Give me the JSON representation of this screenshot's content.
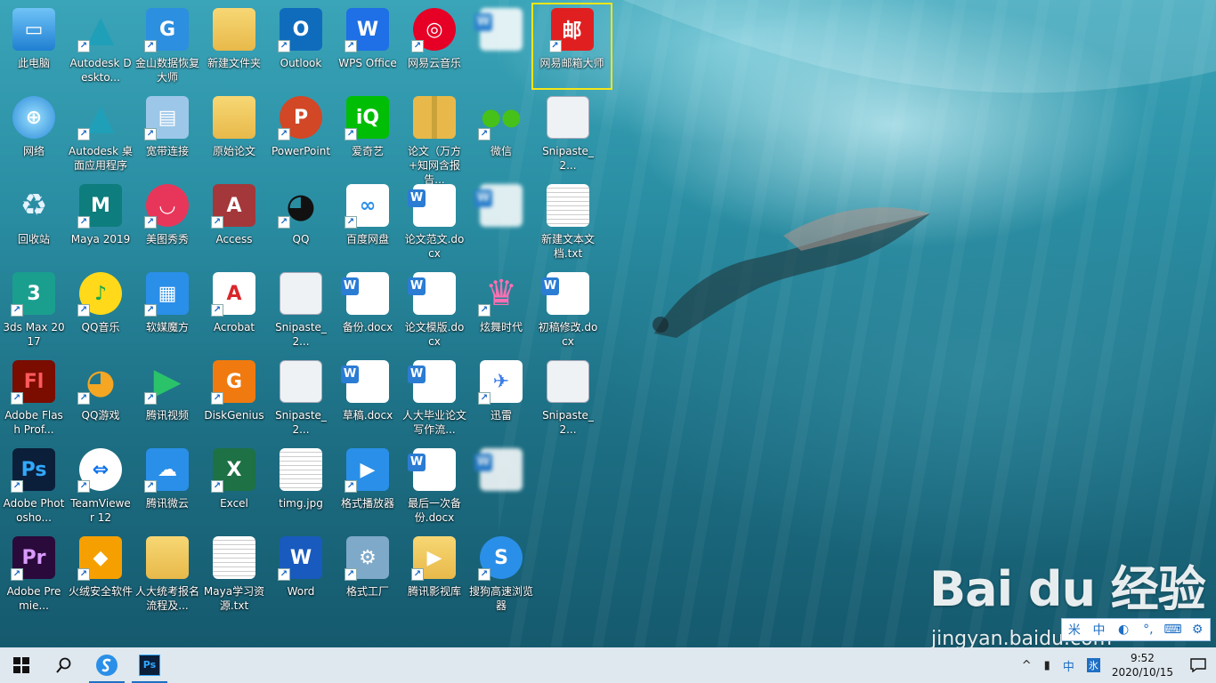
{
  "desktop": {
    "icons": [
      {
        "label": "此电脑",
        "icon": "computer-icon",
        "col": 0,
        "row": 0
      },
      {
        "label": "Autodesk Deskto...",
        "icon": "autodesk-icon",
        "col": 1,
        "row": 0
      },
      {
        "label": "金山数据恢复大师",
        "icon": "recovery-icon",
        "col": 2,
        "row": 0
      },
      {
        "label": "新建文件夹",
        "icon": "folder-icon",
        "col": 3,
        "row": 0
      },
      {
        "label": "Outlook",
        "icon": "outlook-icon",
        "col": 4,
        "row": 0
      },
      {
        "label": "WPS Office",
        "icon": "wps-icon",
        "col": 5,
        "row": 0
      },
      {
        "label": "网易云音乐",
        "icon": "netease-music-icon",
        "col": 6,
        "row": 0
      },
      {
        "label": "",
        "icon": "blurred-doc-icon",
        "col": 7,
        "row": 0
      },
      {
        "label": "网易邮箱大师",
        "icon": "netease-mail-icon",
        "col": 8,
        "row": 0,
        "selected": true
      },
      {
        "label": "网络",
        "icon": "network-icon",
        "col": 0,
        "row": 1
      },
      {
        "label": "Autodesk 桌面应用程序",
        "icon": "autodesk-icon",
        "col": 1,
        "row": 1
      },
      {
        "label": "宽带连接",
        "icon": "broadband-icon",
        "col": 2,
        "row": 1
      },
      {
        "label": "原始论文",
        "icon": "folder-icon",
        "col": 3,
        "row": 1
      },
      {
        "label": "PowerPoint",
        "icon": "powerpoint-icon",
        "col": 4,
        "row": 1
      },
      {
        "label": "爱奇艺",
        "icon": "iqiyi-icon",
        "col": 5,
        "row": 1
      },
      {
        "label": "论文（万方+知网含报告...",
        "icon": "zip-folder-icon",
        "col": 6,
        "row": 1
      },
      {
        "label": "微信",
        "icon": "wechat-icon",
        "col": 7,
        "row": 1
      },
      {
        "label": "Snipaste_2...",
        "icon": "snipaste-icon",
        "col": 8,
        "row": 1
      },
      {
        "label": "回收站",
        "icon": "recycle-bin-icon",
        "col": 0,
        "row": 2
      },
      {
        "label": "Maya 2019",
        "icon": "maya-icon",
        "col": 1,
        "row": 2
      },
      {
        "label": "美图秀秀",
        "icon": "meitu-icon",
        "col": 2,
        "row": 2
      },
      {
        "label": "Access",
        "icon": "access-icon",
        "col": 3,
        "row": 2
      },
      {
        "label": "QQ",
        "icon": "qq-icon",
        "col": 4,
        "row": 2
      },
      {
        "label": "百度网盘",
        "icon": "baidu-netdisk-icon",
        "col": 5,
        "row": 2
      },
      {
        "label": "论文范文.docx",
        "icon": "word-doc-icon",
        "col": 6,
        "row": 2
      },
      {
        "label": "",
        "icon": "blurred-doc-icon",
        "col": 7,
        "row": 2
      },
      {
        "label": "新建文本文档.txt",
        "icon": "text-doc-icon",
        "col": 8,
        "row": 2
      },
      {
        "label": "3ds Max 2017",
        "icon": "3dsmax-icon",
        "col": 0,
        "row": 3
      },
      {
        "label": "QQ音乐",
        "icon": "qq-music-icon",
        "col": 1,
        "row": 3
      },
      {
        "label": "软媒魔方",
        "icon": "ruanmei-icon",
        "col": 2,
        "row": 3
      },
      {
        "label": "Acrobat",
        "icon": "acrobat-icon",
        "col": 3,
        "row": 3
      },
      {
        "label": "Snipaste_2...",
        "icon": "snipaste-icon",
        "col": 4,
        "row": 3
      },
      {
        "label": "备份.docx",
        "icon": "word-doc-icon",
        "col": 5,
        "row": 3
      },
      {
        "label": "论文模版.docx",
        "icon": "word-doc-icon",
        "col": 6,
        "row": 3
      },
      {
        "label": "炫舞时代",
        "icon": "xuanwu-icon",
        "col": 7,
        "row": 3
      },
      {
        "label": "初稿修改.docx",
        "icon": "word-doc-icon",
        "col": 8,
        "row": 3
      },
      {
        "label": "Adobe Flash Prof...",
        "icon": "flash-icon",
        "col": 0,
        "row": 4
      },
      {
        "label": "QQ游戏",
        "icon": "qq-game-icon",
        "col": 1,
        "row": 4
      },
      {
        "label": "腾讯视频",
        "icon": "tencent-video-icon",
        "col": 2,
        "row": 4
      },
      {
        "label": "DiskGenius",
        "icon": "diskgenius-icon",
        "col": 3,
        "row": 4
      },
      {
        "label": "Snipaste_2...",
        "icon": "snipaste-icon",
        "col": 4,
        "row": 4
      },
      {
        "label": "草稿.docx",
        "icon": "word-doc-icon",
        "col": 5,
        "row": 4
      },
      {
        "label": "人大毕业论文写作流...",
        "icon": "word-doc-icon",
        "col": 6,
        "row": 4
      },
      {
        "label": "迅雷",
        "icon": "xunlei-icon",
        "col": 7,
        "row": 4
      },
      {
        "label": "Snipaste_2...",
        "icon": "snipaste-icon",
        "col": 8,
        "row": 4
      },
      {
        "label": "Adobe Photosho...",
        "icon": "photoshop-icon",
        "col": 0,
        "row": 5
      },
      {
        "label": "TeamViewer 12",
        "icon": "teamviewer-icon",
        "col": 1,
        "row": 5
      },
      {
        "label": "腾讯微云",
        "icon": "weiyun-icon",
        "col": 2,
        "row": 5
      },
      {
        "label": "Excel",
        "icon": "excel-icon",
        "col": 3,
        "row": 5
      },
      {
        "label": "timg.jpg",
        "icon": "image-file-icon",
        "col": 4,
        "row": 5
      },
      {
        "label": "格式播放器",
        "icon": "video-player-icon",
        "col": 5,
        "row": 5
      },
      {
        "label": "最后一次备份.docx",
        "icon": "word-doc-icon",
        "col": 6,
        "row": 5
      },
      {
        "label": "",
        "icon": "blurred-doc-icon",
        "col": 7,
        "row": 5
      },
      {
        "label": "Adobe Premie...",
        "icon": "premiere-icon",
        "col": 0,
        "row": 6
      },
      {
        "label": "火绒安全软件",
        "icon": "huorong-icon",
        "col": 1,
        "row": 6
      },
      {
        "label": "人大统考报名流程及...",
        "icon": "folder-doc-icon",
        "col": 2,
        "row": 6
      },
      {
        "label": "Maya学习资源.txt",
        "icon": "text-doc-icon",
        "col": 3,
        "row": 6
      },
      {
        "label": "Word",
        "icon": "word-icon",
        "col": 4,
        "row": 6
      },
      {
        "label": "格式工厂",
        "icon": "format-factory-icon",
        "col": 5,
        "row": 6
      },
      {
        "label": "腾讯影视库",
        "icon": "tencent-video-lib-icon",
        "col": 6,
        "row": 6
      },
      {
        "label": "搜狗高速浏览器",
        "icon": "sogou-browser-icon",
        "col": 7,
        "row": 6
      }
    ]
  },
  "watermark": {
    "brand": "Bai du 经验",
    "url": "jingyan.baidu.com"
  },
  "ime": {
    "items": [
      "米",
      "中",
      "◐",
      "°,",
      "⌨",
      "⚙"
    ]
  },
  "taskbar": {
    "start_icon": "windows-start-icon",
    "tray_items": [
      "^",
      "中",
      "氷"
    ],
    "time": "9:52",
    "date": "2020/10/15"
  },
  "colors": {
    "selection": "#f5e616",
    "taskbar_bg": "#dfe8ee",
    "accent": "#1e6fc4"
  }
}
